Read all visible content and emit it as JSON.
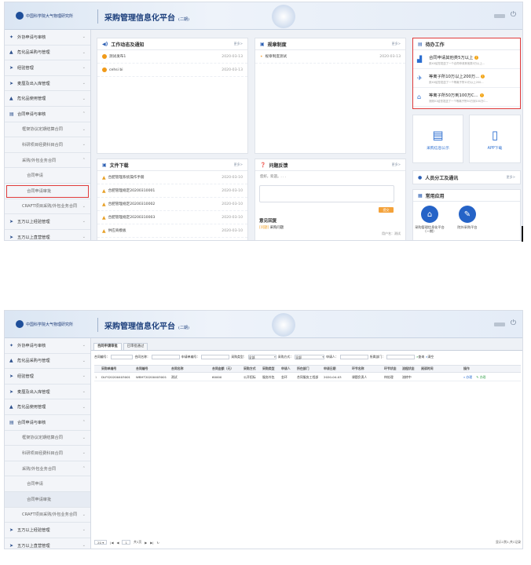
{
  "header": {
    "logo_text": "中国科学院大气物理研究所",
    "title": "采购管理信息化平台",
    "title_sub": "(二期)",
    "power_icon": "power-icon"
  },
  "sidebar": {
    "items": [
      {
        "label": "外协申请与审核",
        "icon": "handshake-icon"
      },
      {
        "label": "危化品采购与管理",
        "icon": "warning-icon"
      },
      {
        "label": "经验管理",
        "icon": "arrow-right-icon"
      },
      {
        "label": "麦厘及出入库管理",
        "icon": "arrow-right-icon"
      },
      {
        "label": "危化品使用管理",
        "icon": "warning-icon"
      },
      {
        "label": "合同申请与审核",
        "icon": "document-icon"
      },
      {
        "label": "框架协议定期结算合同",
        "sub": true
      },
      {
        "label": "科研项目经费科目合同",
        "sub": true
      },
      {
        "label": "采购/外包业务合同",
        "sub": true,
        "expanded": true
      },
      {
        "label": "合同申请",
        "sub2": true
      },
      {
        "label": "合同申请审批",
        "sub2": true
      },
      {
        "label": "CRAFT项目采购/外包业务合同",
        "sub": true
      },
      {
        "label": "五万以上经验管理",
        "icon": "arrow-right-icon"
      },
      {
        "label": "五万以上直营管理",
        "icon": "arrow-right-icon"
      }
    ]
  },
  "notice": {
    "title": "工作动态及通知",
    "more": "更多>",
    "rows": [
      {
        "text": "测试发布1",
        "date": "2020-03-13"
      },
      {
        "text": "cehsi bi",
        "date": "2020-03-13"
      }
    ]
  },
  "rules": {
    "title": "规章制度",
    "more": "更多>",
    "rows": [
      {
        "text": "规章制度测试",
        "date": "2020-03-13"
      }
    ]
  },
  "todo": {
    "title": "待办工作",
    "items": [
      {
        "title": "合同申请其他类5万以上",
        "sub": "张XX给您发送了一个合同申请其他类5万以上..."
      },
      {
        "title": "等离子所10万以上200万...",
        "sub": "张XX给您发送了一个等离子所10万以上200..."
      },
      {
        "title": "等离子所50万到100万C...",
        "sub": "测测01给您发送了一个等离子所50万到100万C..."
      }
    ]
  },
  "tiles": [
    {
      "label": "采购信息公示",
      "icon": "document-list-icon"
    },
    {
      "label": "APP下载",
      "icon": "phone-icon"
    }
  ],
  "files": {
    "title": "文件下载",
    "more": "更多>",
    "rows": [
      {
        "text": "合肥管理系统操作手册",
        "date": "2020-03-10"
      },
      {
        "text": "合肥管理规定20200310001",
        "date": "2020-03-10"
      },
      {
        "text": "合肥管理规定20200310002",
        "date": "2020-03-10"
      },
      {
        "text": "合肥管理规定20200310003",
        "date": "2020-03-10"
      },
      {
        "text": "供应商模板",
        "date": "2020-03-10"
      }
    ]
  },
  "feedback": {
    "title": "问题反馈",
    "more": "更多>",
    "placeholder": "您好，欢迎。. . .",
    "submit": "提交",
    "reply_title": "意见回复",
    "reply_tag": "[问题]",
    "reply_text": "采购问题",
    "reply_user": "用户名：测试"
  },
  "personnel": {
    "title": "人员分工及通讯",
    "more": "更多>"
  },
  "apps": {
    "title": "常用应用",
    "items": [
      {
        "label": "采购管理信息化平台（一期）",
        "icon": "bag-icon"
      },
      {
        "label": "院外采购平台",
        "icon": "pen-icon"
      }
    ]
  },
  "page2": {
    "tabs": [
      "合同申请审批",
      "已审批通过"
    ],
    "filters": [
      "合同编号：",
      "合同名称：",
      "申请单编号：",
      "采购类型：",
      "全部",
      "采购方式：",
      "全部",
      "申请人：",
      "所属部门：",
      "查询",
      "清空"
    ],
    "columns": [
      "采购单编号",
      "合同编号",
      "合同名称",
      "合同金额（元）",
      "采购方式",
      "采购类型",
      "申请人",
      "所在部门",
      "申请日期",
      "环节名称",
      "环节状态",
      "流程状态",
      "阅读时间",
      "操作"
    ],
    "rows": [
      [
        "1",
        "DLFS20200403001",
        "WBHT20200403001",
        "测试",
        "60000",
        "公开招标",
        "服务外包",
        "金环",
        "合同服务工程部",
        "2020-04-03",
        "课题负责人",
        "待处理",
        "流转中",
        "",
        "办理",
        "办理"
      ]
    ],
    "pager": {
      "size": "20",
      "page": "1",
      "of": "共1页",
      "summary": "显示1到1,共1记录"
    }
  }
}
